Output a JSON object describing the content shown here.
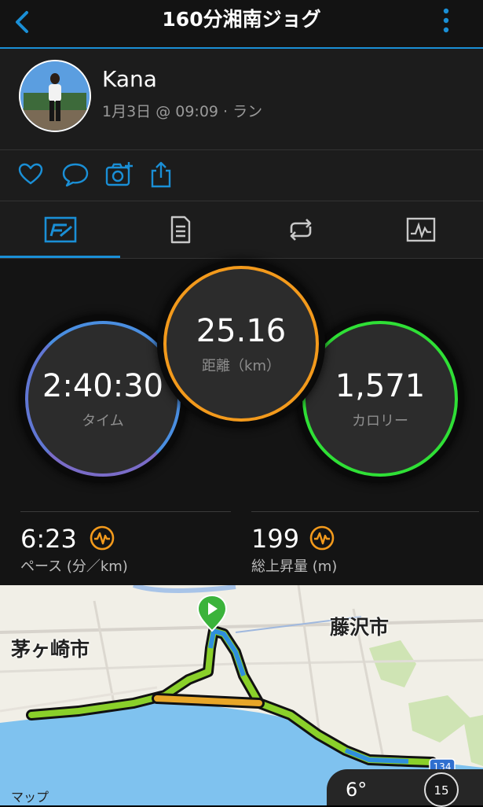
{
  "header": {
    "title": "160分湘南ジョグ"
  },
  "user": {
    "name": "Kana",
    "meta": "1月3日 @ 09:09 · ラン"
  },
  "actions": [
    "heart-icon",
    "comment-icon",
    "add-photo-icon",
    "share-icon"
  ],
  "tabs": [
    {
      "name": "summary",
      "icon": "summary-icon",
      "active": true
    },
    {
      "name": "details",
      "icon": "details-icon",
      "active": false
    },
    {
      "name": "laps",
      "icon": "laps-icon",
      "active": false
    },
    {
      "name": "charts",
      "icon": "charts-icon",
      "active": false
    }
  ],
  "stats": {
    "time": {
      "value": "2:40:30",
      "label": "タイム",
      "color": "#4a8ee0"
    },
    "distance": {
      "value": "25.16",
      "label": "距離（km）",
      "color": "#f39a1c"
    },
    "calories": {
      "value": "1,571",
      "label": "カロリー",
      "color": "#2fe036"
    },
    "pace": {
      "value": "6:23",
      "label": "ペース (分／km)"
    },
    "elevation": {
      "value": "199",
      "label": "総上昇量 (m)"
    }
  },
  "map": {
    "labels": {
      "chigasaki": "茅ヶ崎市",
      "fujisawa": "藤沢市"
    },
    "attribution": "マップ",
    "temperature": "6°",
    "wind": "15",
    "route_sign": "134"
  },
  "colors": {
    "accent": "#1a8fd6",
    "map_water": "#7fc2ef",
    "map_land": "#f1efe7"
  }
}
